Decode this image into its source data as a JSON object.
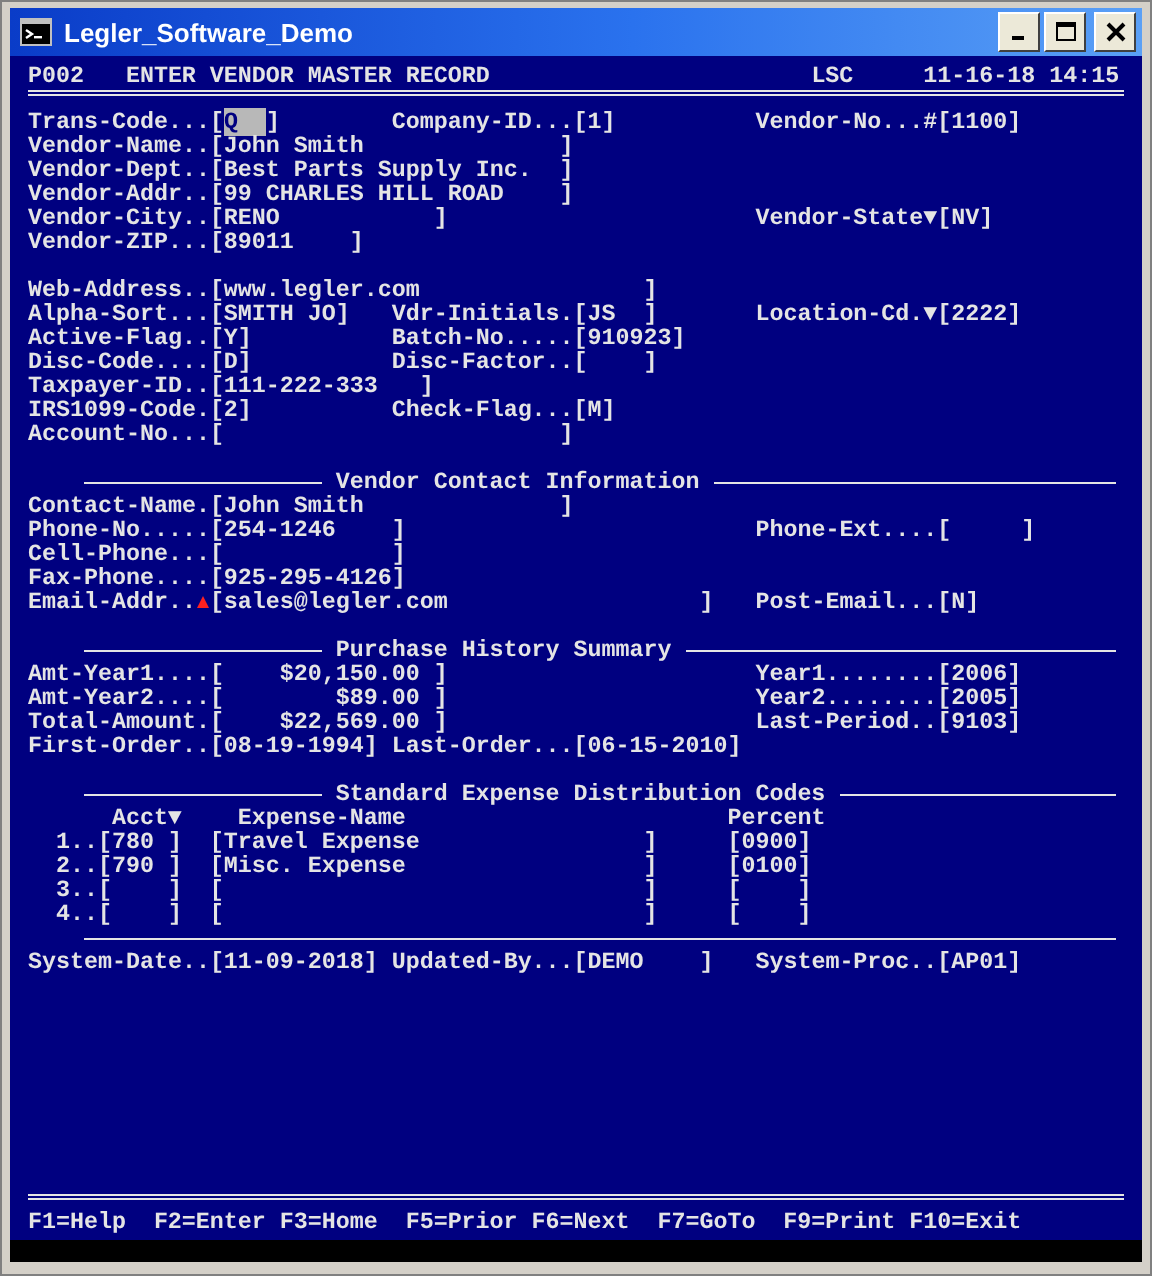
{
  "window": {
    "title": "Legler_Software_Demo"
  },
  "header": {
    "program": "P002",
    "title": "ENTER VENDOR MASTER RECORD",
    "user": "LSC",
    "datetime": "11-16-18 14:15"
  },
  "lines": [
    {
      "kind": "fields",
      "left": {
        "label": "Trans-Code...",
        "value": "[Q  ]",
        "focused": true
      },
      "middle": {
        "label": "Company-ID...",
        "value": "[1]"
      },
      "right": {
        "label": "Vendor-No...#",
        "value": "[1100]"
      }
    },
    {
      "kind": "fields",
      "left": {
        "label": "Vendor-Name..",
        "value": "[John Smith              ]"
      }
    },
    {
      "kind": "fields",
      "left": {
        "label": "Vendor-Dept..",
        "value": "[Best Parts Supply Inc.  ]"
      }
    },
    {
      "kind": "fields",
      "left": {
        "label": "Vendor-Addr..",
        "value": "[99 CHARLES HILL ROAD    ]"
      }
    },
    {
      "kind": "fields",
      "left": {
        "label": "Vendor-City..",
        "value": "[RENO           ]"
      },
      "right": {
        "label": "Vendor-State▼",
        "value": "[NV]"
      }
    },
    {
      "kind": "fields",
      "left": {
        "label": "Vendor-ZIP...",
        "value": "[89011    ]"
      }
    },
    {
      "kind": "blank"
    },
    {
      "kind": "fields",
      "left": {
        "label": "Web-Address..",
        "value": "[www.legler.com                ]"
      }
    },
    {
      "kind": "fields",
      "left": {
        "label": "Alpha-Sort...",
        "value": "[SMITH JO]"
      },
      "middle": {
        "label": "Vdr-Initials.",
        "value": "[JS  ]"
      },
      "right": {
        "label": "Location-Cd.▼",
        "value": "[2222]"
      }
    },
    {
      "kind": "fields",
      "left": {
        "label": "Active-Flag..",
        "value": "[Y]"
      },
      "middle": {
        "label": "Batch-No.....",
        "value": "[910923]"
      }
    },
    {
      "kind": "fields",
      "left": {
        "label": "Disc-Code....",
        "value": "[D]"
      },
      "middle": {
        "label": "Disc-Factor..",
        "value": "[    ]"
      }
    },
    {
      "kind": "fields",
      "left": {
        "label": "Taxpayer-ID..",
        "value": "[111-222-333   ]"
      }
    },
    {
      "kind": "fields",
      "left": {
        "label": "IRS1099-Code.",
        "value": "[2]"
      },
      "middle": {
        "label": "Check-Flag...",
        "value": "[M]"
      }
    },
    {
      "kind": "fields",
      "left": {
        "label": "Account-No...",
        "value": "[                        ]"
      }
    },
    {
      "kind": "blank"
    },
    {
      "kind": "section",
      "title": "Vendor Contact Information"
    },
    {
      "kind": "fields",
      "left": {
        "label": "Contact-Name.",
        "value": "[John Smith              ]"
      }
    },
    {
      "kind": "fields",
      "left": {
        "label": "Phone-No.....",
        "value": "[254-1246    ]"
      },
      "right": {
        "label": "Phone-Ext....",
        "value": "[     ]"
      }
    },
    {
      "kind": "fields",
      "left": {
        "label": "Cell-Phone...",
        "value": "[            ]"
      }
    },
    {
      "kind": "fields",
      "left": {
        "label": "Fax-Phone....",
        "value": "[925-295-4126]"
      }
    },
    {
      "kind": "fields",
      "left": {
        "label": "Email-Addr..",
        "value": "[sales@legler.com                  ]",
        "marker": true
      },
      "right": {
        "label": "Post-Email...",
        "value": "[N]"
      }
    },
    {
      "kind": "blank"
    },
    {
      "kind": "section",
      "title": "Purchase History Summary"
    },
    {
      "kind": "fields",
      "left": {
        "label": "Amt-Year1....",
        "value": "[    $20,150.00 ]"
      },
      "right": {
        "label": "Year1........",
        "value": "[2006]"
      }
    },
    {
      "kind": "fields",
      "left": {
        "label": "Amt-Year2....",
        "value": "[        $89.00 ]"
      },
      "right": {
        "label": "Year2........",
        "value": "[2005]"
      }
    },
    {
      "kind": "fields",
      "left": {
        "label": "Total-Amount.",
        "value": "[    $22,569.00 ]"
      },
      "right": {
        "label": "Last-Period..",
        "value": "[9103]"
      }
    },
    {
      "kind": "fields",
      "left": {
        "label": "First-Order..",
        "value": "[08-19-1994]"
      },
      "middle": {
        "label": "Last-Order...",
        "value": "[06-15-2010]"
      }
    },
    {
      "kind": "blank"
    },
    {
      "kind": "section",
      "title": "Standard Expense Distribution Codes"
    },
    {
      "kind": "table",
      "columns": [
        "Acct▼",
        "Expense-Name",
        "Percent"
      ],
      "rows": [
        {
          "line": "1..",
          "acct": "[780 ]",
          "name": "[Travel Expense                ]",
          "percent": "[0900]"
        },
        {
          "line": "2..",
          "acct": "[790 ]",
          "name": "[Misc. Expense                 ]",
          "percent": "[0100]"
        },
        {
          "line": "3..",
          "acct": "[    ]",
          "name": "[                              ]",
          "percent": "[    ]"
        },
        {
          "line": "4..",
          "acct": "[    ]",
          "name": "[                              ]",
          "percent": "[    ]"
        }
      ]
    },
    {
      "kind": "rule"
    },
    {
      "kind": "fields",
      "left": {
        "label": "System-Date..",
        "value": "[11-09-2018]"
      },
      "middle": {
        "label": "Updated-By...",
        "value": "[DEMO    ]"
      },
      "right": {
        "label": "System-Proc..",
        "value": "[AP01]"
      }
    }
  ],
  "function_keys": [
    "F1=Help",
    "F2=Enter",
    "F3=Home",
    "F5=Prior",
    "F6=Next",
    "F7=GoTo",
    "F9=Print",
    "F10=Exit"
  ]
}
